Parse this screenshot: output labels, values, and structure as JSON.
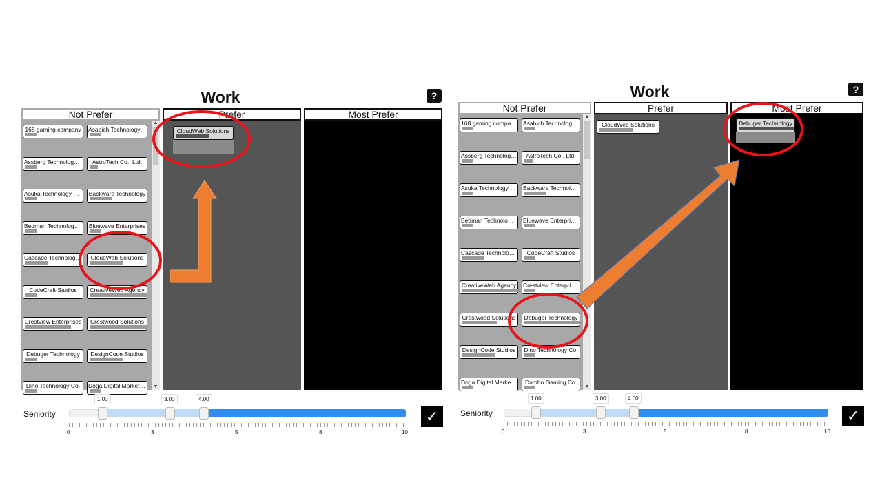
{
  "title": "Work",
  "help_label": "?",
  "columns": {
    "not_prefer": "Not Prefer",
    "prefer": "Prefer",
    "most_prefer": "Most Prefer"
  },
  "left": {
    "not_prefer_items": [
      "168 gaming company",
      "Asabich Technology Co.",
      "Assberg Technology Co.",
      "AstroTech Co., Ltd.",
      "Asuka Technology Co.",
      "Backware Technology",
      "Bedman Technology Co.",
      "Bluewave Enterprises",
      "Cascade Technologies",
      "CloudWeb Solutions",
      "CodeCraft Studios",
      "CreativeWeb Agency",
      "Crestview Enterprises",
      "Crestwood Solutions",
      "Debuger Technology",
      "DesignCode Studios",
      "Dino Technology Co.",
      "Doga Digital Marketing"
    ],
    "prefer_items": [
      "CloudWeb Solutions"
    ],
    "most_prefer_items": []
  },
  "right": {
    "not_prefer_items": [
      "168 gaming company",
      "Asabich Technology Co.",
      "Assberg Technology Co.",
      "AstroTech Co., Ltd.",
      "Asuka Technology Co.",
      "Backware Technology",
      "Bedman Technology Co.",
      "Bluewave Enterprises",
      "Cascade Technologies",
      "CodeCraft Studios",
      "CreativeWeb Agency",
      "Crestview Enterprises",
      "Crestwood Solutions",
      "Debuger Technology",
      "DesignCode Studios",
      "Dino Technology Co.",
      "Doga Digital Marketing",
      "Dumbo Gaming Co."
    ],
    "prefer_items": [
      "CloudWeb Solutions"
    ],
    "most_prefer_items": [
      "Debuger Technology"
    ]
  },
  "slider": {
    "label": "Seniority",
    "handle_values": [
      "1.00",
      "3.00",
      "4.00"
    ],
    "tick_labels": [
      "0",
      "3",
      "5",
      "8",
      "10"
    ],
    "range_min": 0,
    "range_max": 10
  },
  "confirm_label": "✓",
  "colors": {
    "annotation_red": "#e8141a",
    "arrow_orange": "#ed7d31",
    "slider_blue": "#2f8ef0"
  }
}
